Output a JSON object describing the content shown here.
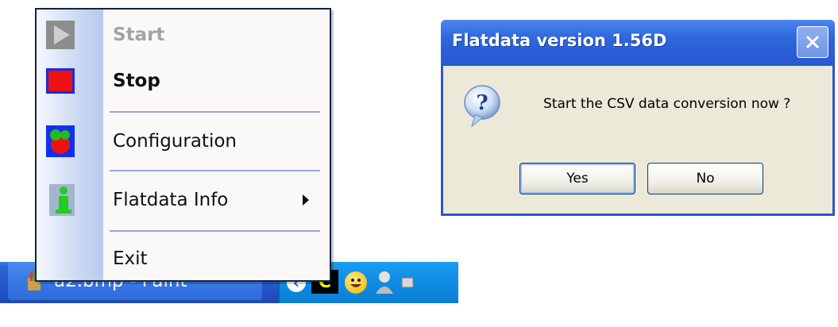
{
  "menu": {
    "items": [
      {
        "label": "Start",
        "state": "disabled"
      },
      {
        "label": "Stop"
      },
      {
        "label": "Configuration"
      },
      {
        "label": "Flatdata Info",
        "submenu": true
      },
      {
        "label": "Exit"
      }
    ]
  },
  "taskbar": {
    "task_label": "a2.bmp - Paint",
    "tray_co_text": "C"
  },
  "dialog": {
    "title": "Flatdata version 1.56D",
    "message": "Start the CSV data conversion now ?",
    "yes_label": "Yes",
    "no_label": "No"
  },
  "colors": {
    "taskbar_blue": "#2456c8",
    "tray_blue": "#0f8fe6",
    "dialog_bg": "#ece9d8",
    "title_blue": "#2e66dc"
  }
}
